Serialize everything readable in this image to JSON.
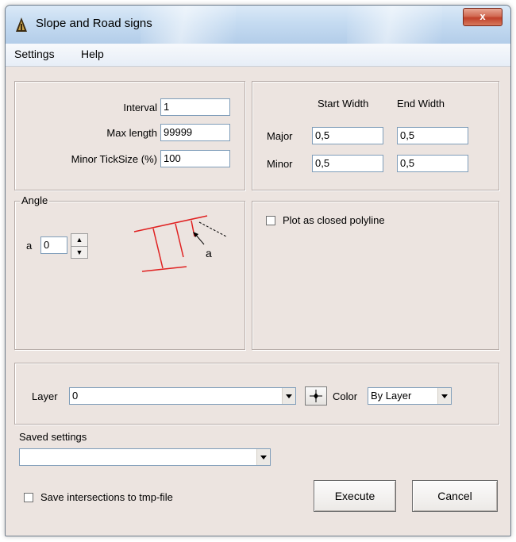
{
  "window": {
    "title": "Slope and Road signs",
    "close_glyph": "x"
  },
  "menu": {
    "items": [
      "Settings",
      "Help"
    ]
  },
  "settings": {
    "interval_label": "Interval",
    "interval_value": "1",
    "max_length_label": "Max length",
    "max_length_value": "99999",
    "minor_ticksize_label": "Minor TickSize (%)",
    "minor_ticksize_value": "100"
  },
  "widths": {
    "start_header": "Start Width",
    "end_header": "End Width",
    "major_label": "Major",
    "major_start": "0,5",
    "major_end": "0,5",
    "minor_label": "Minor",
    "minor_start": "0,5",
    "minor_end": "0,5"
  },
  "angle": {
    "group_title": "Angle",
    "a_label": "a",
    "a_value": "0",
    "diagram_label": "a",
    "diagram_color": "#e02020"
  },
  "plot": {
    "closed_polyline_label": "Plot as closed polyline",
    "closed_polyline_checked": false
  },
  "layer": {
    "label": "Layer",
    "value": "0",
    "color_label": "Color",
    "color_value": "By Layer",
    "pick_icon": "crosshair-icon"
  },
  "saved": {
    "label": "Saved settings",
    "value": ""
  },
  "footer": {
    "save_intersections_label": "Save intersections to tmp-file",
    "save_intersections_checked": false,
    "execute_label": "Execute",
    "cancel_label": "Cancel"
  }
}
